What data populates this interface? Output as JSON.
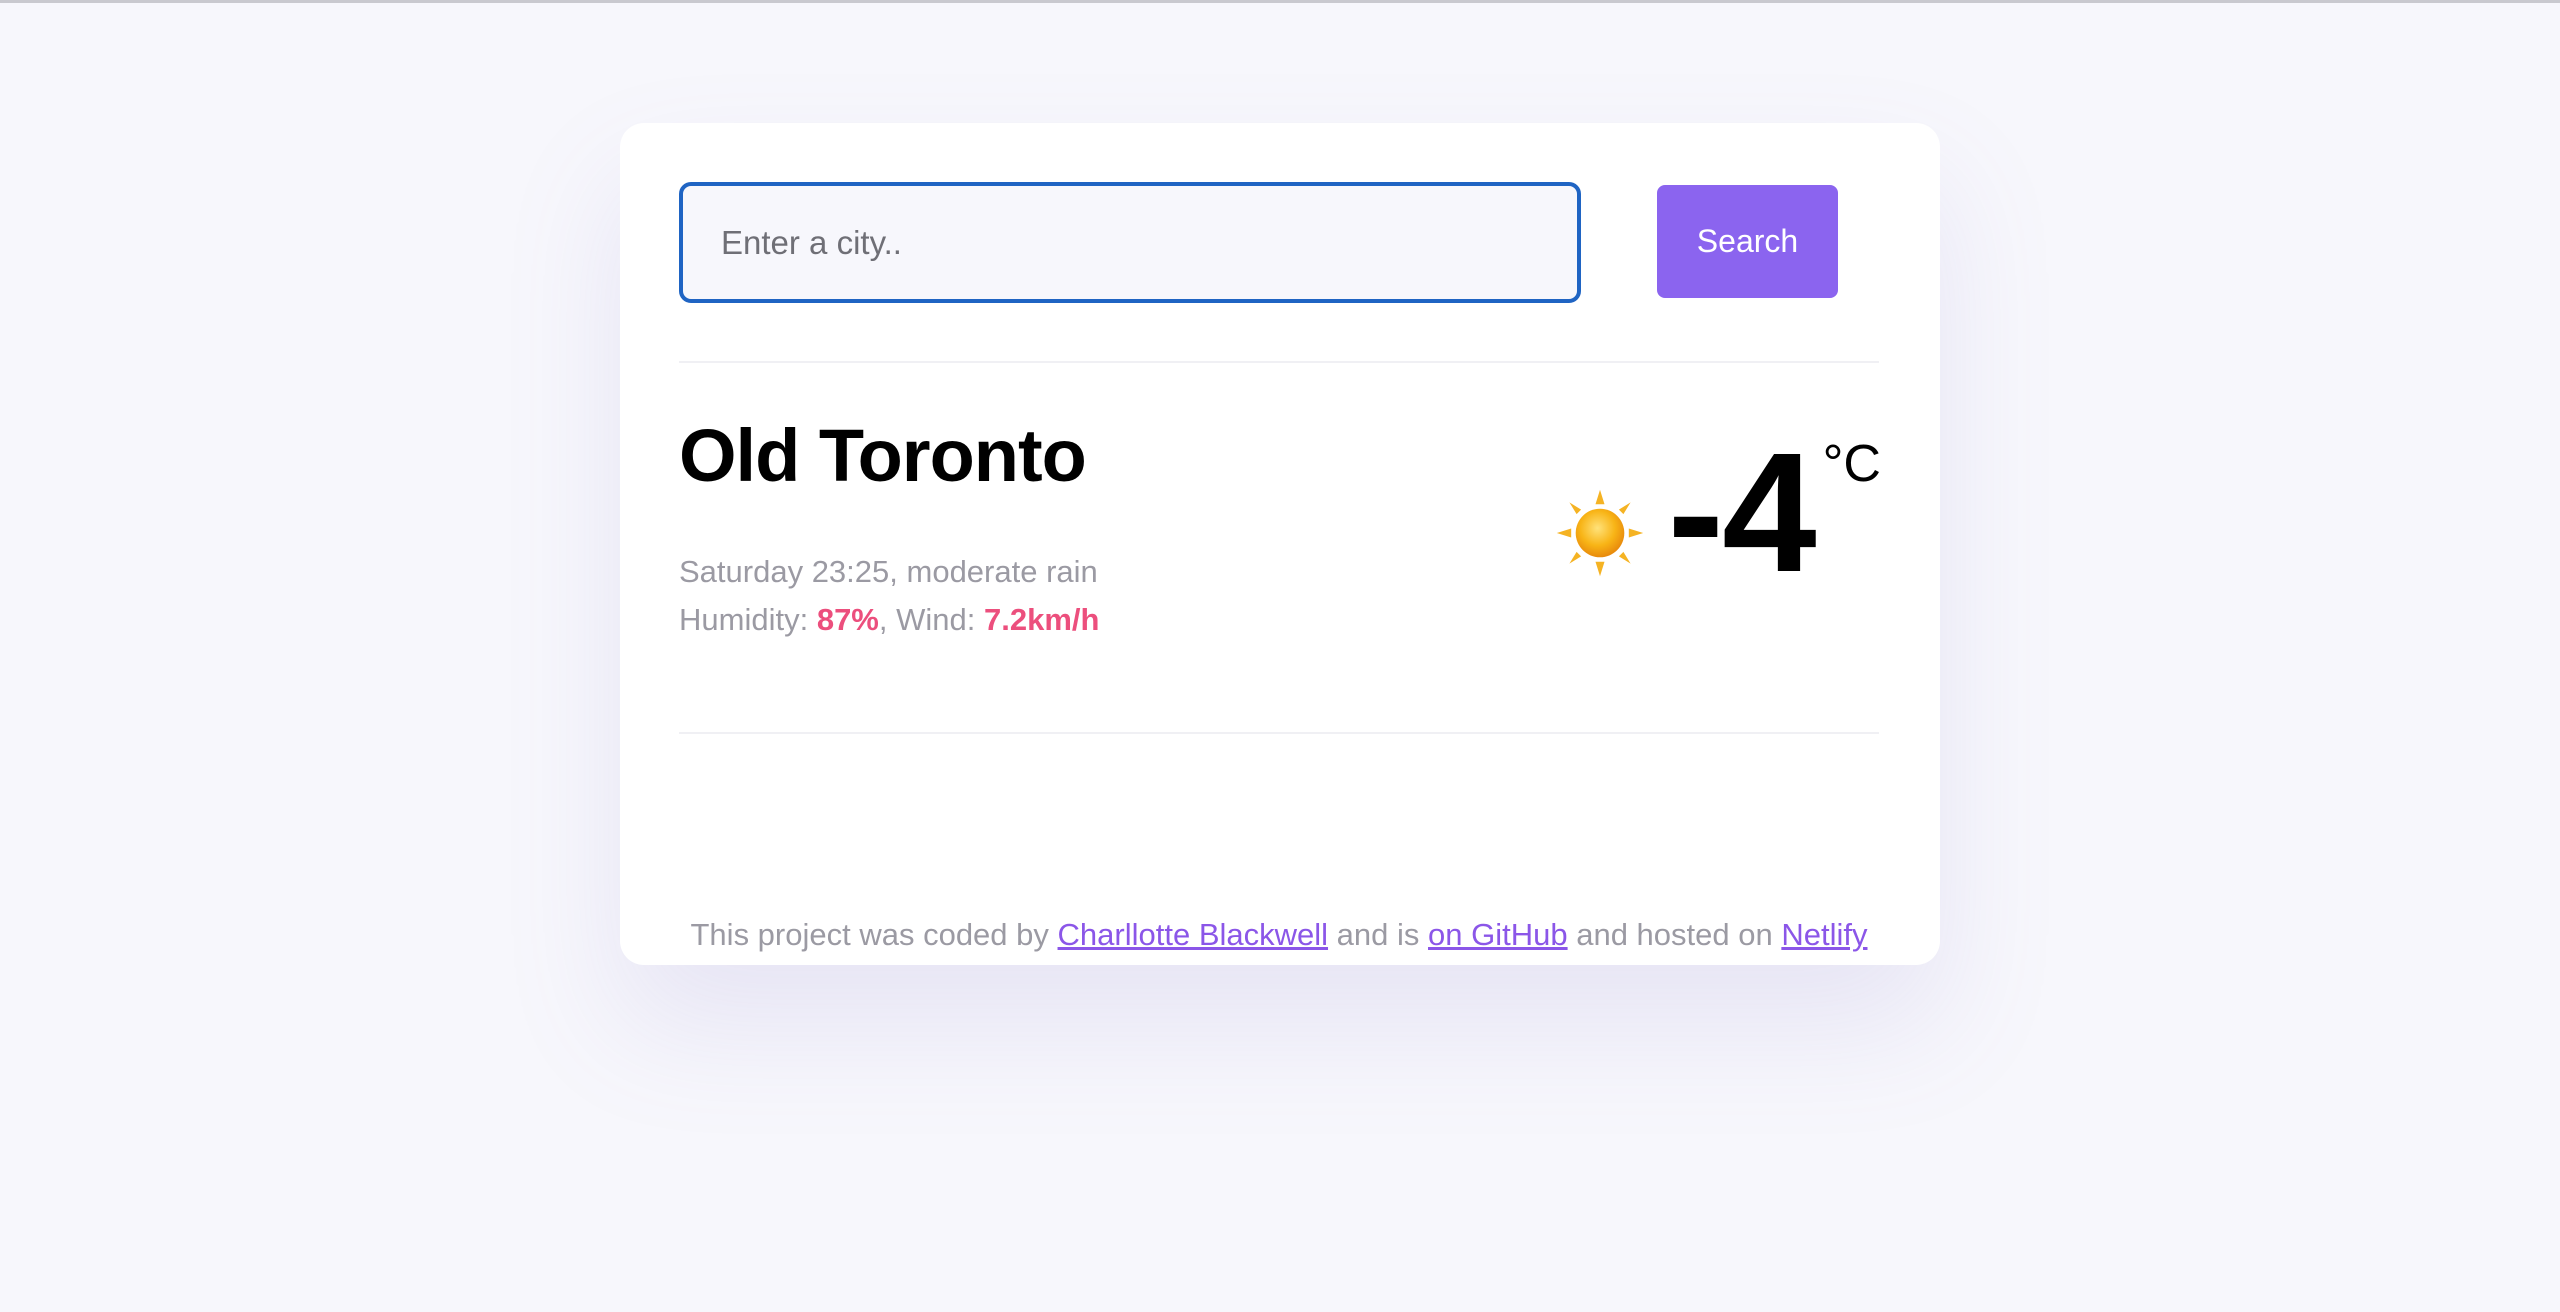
{
  "search": {
    "placeholder": "Enter a city..",
    "value": "",
    "button_label": "Search"
  },
  "weather": {
    "city": "Old Toronto",
    "datetime": "Saturday 23:25",
    "description": "moderate rain",
    "humidity_label": "Humidity:",
    "humidity_value": "87%",
    "wind_label": "Wind:",
    "wind_value": "7.2km/h",
    "temperature": "-4",
    "unit": "°C",
    "icon": "sun-icon"
  },
  "footer": {
    "text_1": "This project was coded by",
    "author": "Charllotte Blackwell",
    "text_2": "and is",
    "github_link": "on GitHub",
    "text_3": "and hosted on",
    "netlify_link": "Netlify"
  },
  "colors": {
    "background": "#f7f7fc",
    "accent": "#8b64ef",
    "highlight": "#ec4f7d",
    "input_border": "#1f64c3"
  }
}
